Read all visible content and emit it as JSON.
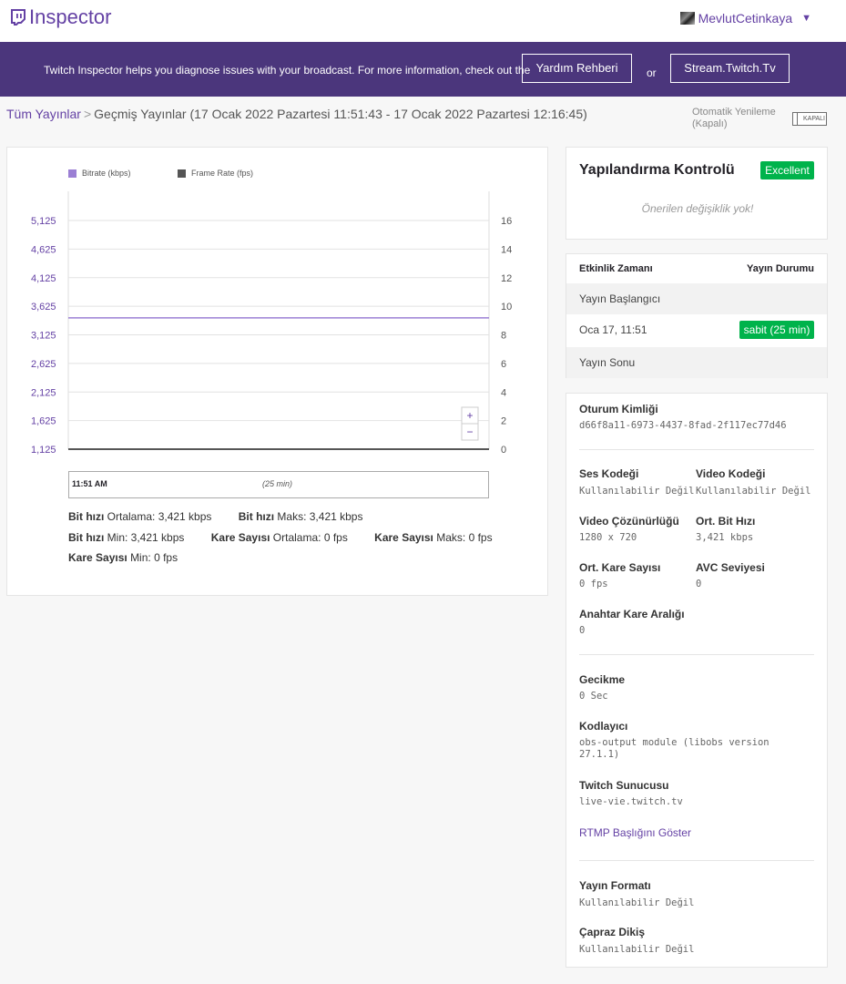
{
  "header": {
    "logo_text": "Inspector",
    "username": "MevlutCetinkaya",
    "caret": "▼"
  },
  "banner": {
    "text": "Twitch Inspector helps you diagnose issues with your broadcast. For more information, check out the",
    "help_button": "Yardım Rehberi",
    "or": "or",
    "stream_button": "Stream.Twitch.Tv"
  },
  "breadcrumb": {
    "root": "Tüm Yayınlar",
    "separator": ">",
    "current": "Geçmiş Yayınlar (17 Ocak 2022 Pazartesi 11:51:43 - 17 Ocak 2022 Pazartesi 12:16:45)"
  },
  "autorefresh": {
    "label": "Otomatik Yenileme",
    "state": "(Kapalı)",
    "toggle_text": "KAPALI"
  },
  "chart_data": {
    "type": "line",
    "series": [
      {
        "name": "Bitrate (kbps)",
        "axis": "left",
        "color": "#9b7fd4",
        "values": [
          3421,
          3421
        ]
      },
      {
        "name": "Frame Rate (fps)",
        "axis": "right",
        "color": "#555555",
        "values": [
          0,
          0
        ]
      }
    ],
    "y_left_ticks": [
      "5,125",
      "4,625",
      "4,125",
      "3,625",
      "3,125",
      "2,625",
      "2,125",
      "1,625",
      "1,125"
    ],
    "y_left_range": [
      1125,
      5125
    ],
    "y_right_ticks": [
      "16",
      "14",
      "12",
      "10",
      "8",
      "6",
      "4",
      "2",
      "0"
    ],
    "y_right_range": [
      0,
      16
    ],
    "grid": true,
    "legend_position": "top-left"
  },
  "chart": {
    "zoom_in": "+",
    "zoom_out": "−",
    "timeline_start": "11:51 AM",
    "timeline_duration": "(25 min)"
  },
  "stats": {
    "row1": [
      {
        "label": "Bit hızı",
        "text": "Ortalama: 3,421 kbps"
      },
      {
        "label": "Bit hızı",
        "text": "Maks: 3,421 kbps"
      }
    ],
    "row2": [
      {
        "label": "Bit hızı",
        "text": "Min: 3,421 kbps"
      },
      {
        "label": "Kare Sayısı",
        "text": "Ortalama: 0 fps"
      },
      {
        "label": "Kare Sayısı",
        "text": "Maks: 0 fps"
      }
    ],
    "row3": [
      {
        "label": "Kare Sayısı",
        "text": "Min: 0 fps"
      }
    ]
  },
  "config": {
    "title": "Yapılandırma Kontrolü",
    "badge": "Excellent",
    "message": "Önerilen değişiklik yok!"
  },
  "events": {
    "col_time": "Etkinlik Zamanı",
    "col_status": "Yayın Durumu",
    "start_label": "Yayın Başlangıcı",
    "time": "Oca 17, 11:51",
    "status": "sabit (25 min)",
    "end_label": "Yayın Sonu"
  },
  "session": {
    "id_label": "Oturum Kimliği",
    "id_value": "d66f8a11-6973-4437-8fad-2f117ec77d46",
    "audio_codec_label": "Ses Kodeği",
    "audio_codec_value": "Kullanılabilir Değil",
    "video_codec_label": "Video Kodeği",
    "video_codec_value": "Kullanılabilir Değil",
    "resolution_label": "Video Çözünürlüğü",
    "resolution_value": "1280 x 720",
    "avg_bitrate_label": "Ort. Bit Hızı",
    "avg_bitrate_value": "3,421 kbps",
    "avg_fps_label": "Ort. Kare Sayısı",
    "avg_fps_value": "0 fps",
    "avc_label": "AVC Seviyesi",
    "avc_value": "0",
    "keyframe_label": "Anahtar Kare Aralığı",
    "keyframe_value": "0",
    "latency_label": "Gecikme",
    "latency_value": "0 Sec",
    "encoder_label": "Kodlayıcı",
    "encoder_value_line1": "obs-output module (libobs version",
    "encoder_value_line2": "27.1.1)",
    "server_label": "Twitch Sunucusu",
    "server_value": "live-vie.twitch.tv",
    "rtmp_link": "RTMP Başlığını Göster",
    "format_label": "Yayın Formatı",
    "format_value": "Kullanılabilir Değil",
    "interlace_label": "Çapraz Dikiş",
    "interlace_value": "Kullanılabilir Değil"
  }
}
